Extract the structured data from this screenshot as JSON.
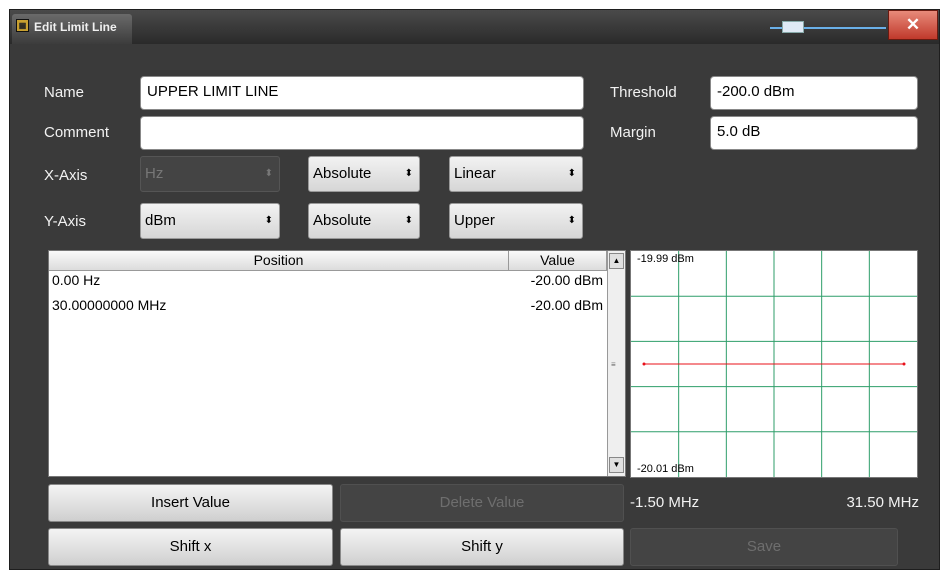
{
  "window": {
    "title": "Edit Limit Line",
    "close_label": "✕"
  },
  "form": {
    "name_label": "Name",
    "name_value": "UPPER LIMIT LINE",
    "comment_label": "Comment",
    "comment_value": "",
    "threshold_label": "Threshold",
    "threshold_value": "-200.0 dBm",
    "margin_label": "Margin",
    "margin_value": "5.0 dB",
    "xaxis_label": "X-Axis",
    "xaxis_unit": "Hz",
    "xaxis_mode": "Absolute",
    "xaxis_scale": "Linear",
    "yaxis_label": "Y-Axis",
    "yaxis_unit": "dBm",
    "yaxis_mode": "Absolute",
    "yaxis_type": "Upper"
  },
  "table": {
    "headers": {
      "position": "Position",
      "value": "Value"
    },
    "rows": [
      {
        "position": "0.00 Hz",
        "value": "-20.00 dBm"
      },
      {
        "position": "30.00000000 MHz",
        "value": "-20.00 dBm"
      }
    ]
  },
  "preview": {
    "y_top": "-19.99 dBm",
    "y_bottom": "-20.01 dBm",
    "x_start": "-1.50 MHz",
    "x_stop": "31.50 MHz",
    "grid_color": "#2e9e6a",
    "line_color": "#e8101a"
  },
  "chart_data": {
    "type": "line",
    "series": [
      {
        "x": [
          0,
          30
        ],
        "y": [
          -20.0,
          -20.0
        ]
      }
    ],
    "x_unit": "MHz",
    "xlim": [
      -1.5,
      31.5
    ],
    "ylim": [
      -20.01,
      -19.99
    ],
    "grid": true
  },
  "buttons": {
    "insert": "Insert Value",
    "delete": "Delete Value",
    "shift_x": "Shift x",
    "shift_y": "Shift y",
    "save": "Save"
  }
}
